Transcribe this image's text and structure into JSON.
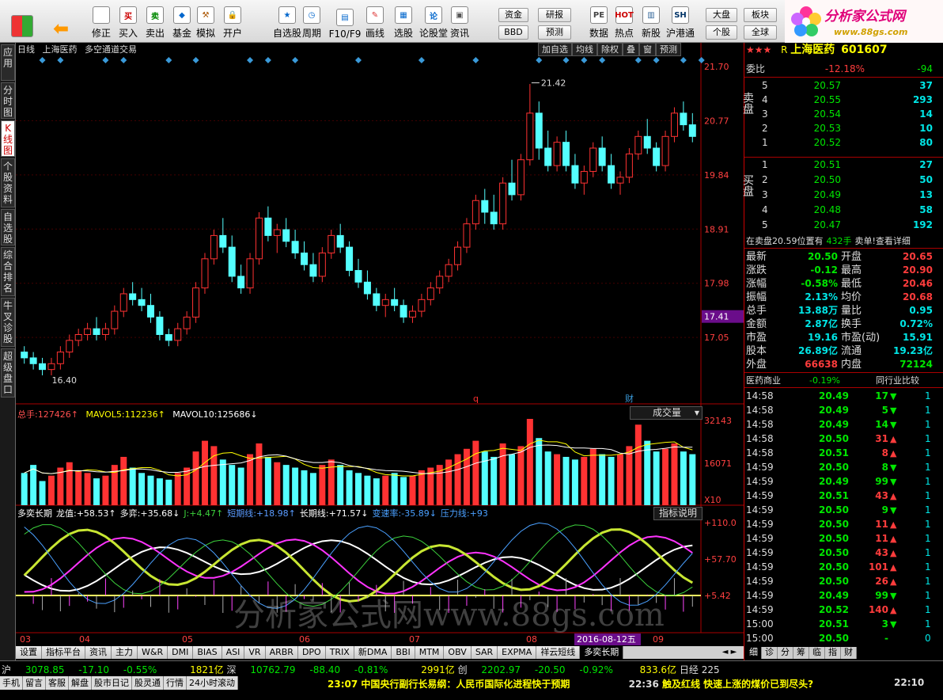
{
  "toolbar": {
    "buttons": [
      {
        "label": "修正",
        "icon": "back-arrow-icon"
      },
      {
        "label": "买入",
        "icon": "buy-icon",
        "glyph": "买"
      },
      {
        "label": "卖出",
        "icon": "sell-icon",
        "glyph": "卖"
      },
      {
        "label": "基金",
        "icon": "fund-icon",
        "glyph": "◆"
      },
      {
        "label": "模拟",
        "icon": "hammer-icon",
        "glyph": "⚒"
      },
      {
        "label": "开户",
        "icon": "lock-icon",
        "glyph": "🔒"
      },
      {
        "label": "自选股",
        "icon": "star-icon",
        "glyph": "★"
      },
      {
        "label": "周期",
        "icon": "clock-icon",
        "glyph": "◷"
      },
      {
        "label": "F10/F9",
        "icon": "f10-icon",
        "glyph": "▤"
      },
      {
        "label": "画线",
        "icon": "pen-icon",
        "glyph": "✎"
      },
      {
        "label": "选股",
        "icon": "chart-icon",
        "glyph": "▦"
      },
      {
        "label": "论股堂",
        "icon": "talk-icon",
        "glyph": "论"
      },
      {
        "label": "资讯",
        "icon": "info-icon",
        "glyph": "▣"
      },
      {
        "label": "数据",
        "icon": "pe-icon",
        "glyph": "PE"
      },
      {
        "label": "热点",
        "icon": "hot-icon",
        "glyph": "HOT"
      },
      {
        "label": "新股",
        "icon": "newstock-icon",
        "glyph": "▥"
      },
      {
        "label": "沪港通",
        "icon": "hk-icon",
        "glyph": "SH"
      }
    ],
    "small": [
      "资金",
      "BBD",
      "研报",
      "预测",
      "大盘",
      "个股",
      "板块",
      "全球"
    ],
    "logo_title": "分析家公式网",
    "logo_url": "www.88gs.com"
  },
  "left_tabs": [
    "应用",
    "分时图",
    "K线图",
    "个股资料",
    "自选股",
    "综合排名",
    "牛叉诊股",
    "超级盘口"
  ],
  "chart": {
    "header": {
      "period": "日线",
      "stock": "上海医药",
      "formula": "多空通道交易"
    },
    "header_btns": [
      "加自选",
      "均线",
      "除权",
      "叠",
      "窗",
      "预测"
    ],
    "price_axis": [
      "21.70",
      "20.77",
      "19.84",
      "18.91",
      "17.98",
      "17.05"
    ],
    "current_price_label": "17.41",
    "high_mark": "21.42",
    "low_mark": "16.40",
    "event_labels": [
      "q",
      "财"
    ],
    "vol_header": {
      "label": "总手:",
      "total": "127426↑",
      "mavol5_label": "MAVOL5:",
      "mavol5": "112236↑",
      "mavol10_label": "MAVOL10:",
      "mavol10": "125686↓"
    },
    "vol_menu": "成交量",
    "vol_axis": [
      "32143",
      "16071"
    ],
    "vol_unit": "X10",
    "ind_header": {
      "name": "多奕长期",
      "items": [
        {
          "t": "龙值:",
          "v": "+58.53↑",
          "c": "#fff"
        },
        {
          "t": "多弈:",
          "v": "+35.68↓",
          "c": "#fff"
        },
        {
          "t": "J:",
          "v": "+4.47↑",
          "c": "#3cd23c"
        },
        {
          "t": "短期线:",
          "v": "+18.98↑",
          "c": "#5a9bff"
        },
        {
          "t": "长期线:",
          "v": "+71.57↓",
          "c": "#fff"
        },
        {
          "t": "变速率:",
          "v": "-35.89↓",
          "c": "#4aa0ff"
        },
        {
          "t": "压力线:",
          "v": "+93",
          "c": "#4aa0ff"
        }
      ]
    },
    "ind_menu": "指标说明",
    "ind_axis": [
      "+110.0",
      "+57.70",
      "+5.42"
    ],
    "watermark": "分析家公式网www.88gs.com",
    "months": [
      "03",
      "04",
      "05",
      "06",
      "07",
      "08",
      "09"
    ],
    "date_highlight": "2016-08-12五"
  },
  "chart_data": {
    "type": "candlestick",
    "title": "上海医药 日线",
    "ylim": [
      16.4,
      21.7
    ],
    "candles": [
      [
        16.8,
        16.9,
        16.6,
        16.7
      ],
      [
        16.7,
        16.8,
        16.5,
        16.6
      ],
      [
        16.6,
        16.7,
        16.4,
        16.5
      ],
      [
        16.5,
        16.7,
        16.4,
        16.6
      ],
      [
        16.6,
        16.9,
        16.5,
        16.8
      ],
      [
        16.8,
        17.1,
        16.7,
        17.0
      ],
      [
        17.0,
        17.2,
        16.9,
        17.1
      ],
      [
        17.1,
        17.3,
        17.0,
        17.2
      ],
      [
        17.2,
        17.4,
        17.0,
        17.1
      ],
      [
        17.1,
        17.3,
        17.0,
        17.2
      ],
      [
        17.2,
        17.6,
        17.1,
        17.5
      ],
      [
        17.5,
        17.9,
        17.4,
        17.8
      ],
      [
        17.8,
        18.0,
        17.6,
        17.7
      ],
      [
        17.7,
        17.9,
        17.5,
        17.6
      ],
      [
        17.6,
        17.8,
        17.3,
        17.4
      ],
      [
        17.4,
        17.5,
        17.0,
        17.1
      ],
      [
        17.1,
        17.2,
        16.9,
        17.0
      ],
      [
        17.0,
        17.3,
        16.9,
        17.2
      ],
      [
        17.2,
        17.5,
        17.1,
        17.4
      ],
      [
        17.4,
        18.0,
        17.3,
        17.9
      ],
      [
        17.9,
        18.5,
        17.8,
        18.4
      ],
      [
        18.4,
        18.9,
        18.3,
        18.8
      ],
      [
        18.8,
        19.1,
        18.5,
        18.6
      ],
      [
        18.6,
        18.8,
        18.0,
        18.1
      ],
      [
        18.1,
        18.3,
        17.8,
        17.9
      ],
      [
        17.9,
        18.5,
        17.8,
        18.4
      ],
      [
        18.4,
        19.2,
        18.3,
        19.1
      ],
      [
        19.1,
        19.3,
        18.7,
        18.8
      ],
      [
        18.8,
        19.0,
        18.5,
        18.9
      ],
      [
        18.9,
        19.1,
        18.6,
        18.7
      ],
      [
        18.7,
        18.9,
        18.4,
        18.5
      ],
      [
        18.5,
        18.7,
        18.2,
        18.3
      ],
      [
        18.3,
        18.5,
        18.0,
        18.1
      ],
      [
        18.1,
        18.6,
        18.0,
        18.5
      ],
      [
        18.5,
        18.9,
        18.4,
        18.8
      ],
      [
        18.8,
        19.0,
        18.5,
        18.6
      ],
      [
        18.6,
        18.7,
        18.1,
        18.2
      ],
      [
        18.2,
        18.4,
        17.9,
        18.0
      ],
      [
        18.0,
        18.2,
        17.7,
        17.8
      ],
      [
        17.8,
        17.9,
        17.5,
        17.6
      ],
      [
        17.6,
        17.8,
        17.4,
        17.7
      ],
      [
        17.7,
        17.9,
        17.5,
        17.6
      ],
      [
        17.6,
        17.7,
        17.3,
        17.4
      ],
      [
        17.4,
        17.6,
        17.3,
        17.5
      ],
      [
        17.5,
        17.8,
        17.4,
        17.7
      ],
      [
        17.7,
        18.0,
        17.6,
        17.9
      ],
      [
        17.9,
        18.2,
        17.8,
        18.1
      ],
      [
        18.1,
        18.4,
        18.0,
        18.3
      ],
      [
        18.3,
        18.7,
        18.2,
        18.6
      ],
      [
        18.6,
        19.1,
        18.5,
        19.0
      ],
      [
        19.0,
        19.5,
        18.9,
        19.4
      ],
      [
        19.4,
        19.6,
        19.0,
        19.2
      ],
      [
        19.2,
        19.5,
        18.9,
        19.0
      ],
      [
        19.0,
        19.8,
        18.9,
        19.7
      ],
      [
        19.7,
        20.1,
        19.4,
        19.5
      ],
      [
        19.5,
        20.2,
        19.4,
        20.1
      ],
      [
        20.1,
        21.4,
        20.0,
        20.9
      ],
      [
        20.9,
        21.1,
        20.1,
        20.3
      ],
      [
        20.3,
        20.6,
        19.9,
        20.0
      ],
      [
        20.0,
        20.5,
        19.9,
        20.4
      ],
      [
        20.4,
        20.6,
        19.9,
        20.0
      ],
      [
        20.0,
        20.2,
        19.6,
        19.7
      ],
      [
        19.7,
        20.0,
        19.5,
        19.9
      ],
      [
        19.9,
        20.4,
        19.8,
        20.3
      ],
      [
        20.3,
        20.5,
        19.9,
        20.0
      ],
      [
        20.0,
        20.2,
        19.6,
        19.7
      ],
      [
        19.7,
        19.9,
        19.5,
        19.8
      ],
      [
        19.8,
        20.3,
        19.7,
        20.2
      ],
      [
        20.2,
        20.6,
        20.1,
        20.5
      ],
      [
        20.5,
        20.8,
        20.2,
        20.3
      ],
      [
        20.3,
        20.4,
        19.9,
        20.0
      ],
      [
        20.0,
        20.6,
        19.9,
        20.5
      ],
      [
        20.5,
        21.0,
        20.4,
        20.9
      ],
      [
        20.9,
        21.1,
        20.6,
        20.7
      ],
      [
        20.7,
        20.9,
        20.4,
        20.5
      ]
    ],
    "volume": [
      12000,
      15000,
      9000,
      11000,
      14000,
      16000,
      13000,
      12000,
      10000,
      11000,
      15000,
      18000,
      14000,
      12000,
      11000,
      10000,
      9500,
      12000,
      14000,
      20000,
      24000,
      22000,
      17000,
      15000,
      14000,
      19000,
      23000,
      18000,
      16000,
      15000,
      14000,
      13000,
      12000,
      15000,
      17000,
      15000,
      13000,
      12000,
      11000,
      10000,
      11000,
      12000,
      10500,
      11000,
      13000,
      14000,
      15000,
      17000,
      19000,
      21000,
      24000,
      20000,
      18000,
      23000,
      19000,
      22000,
      32143,
      25000,
      20000,
      19000,
      18000,
      17000,
      18000,
      21000,
      19000,
      18000,
      19000,
      22000,
      30000,
      24000,
      20000,
      21000,
      23000,
      20000,
      19000
    ]
  },
  "quote": {
    "stars": "★★★",
    "flag": "R",
    "name": "上海医药",
    "code": "601607",
    "weibi_label": "委比",
    "weibi": "-12.18%",
    "weicha": "-94",
    "sell_label": "卖盘",
    "buy_label": "买盘",
    "sells": [
      [
        "5",
        "20.57",
        "37"
      ],
      [
        "4",
        "20.55",
        "293"
      ],
      [
        "3",
        "20.54",
        "14"
      ],
      [
        "2",
        "20.53",
        "10"
      ],
      [
        "1",
        "20.52",
        "80"
      ]
    ],
    "buys": [
      [
        "1",
        "20.51",
        "27"
      ],
      [
        "2",
        "20.50",
        "50"
      ],
      [
        "3",
        "20.49",
        "13"
      ],
      [
        "4",
        "20.48",
        "58"
      ],
      [
        "5",
        "20.47",
        "192"
      ]
    ],
    "notice": "在卖盘20.59位置有",
    "notice_qty": "432手",
    "notice_tail": "卖单!查看详细",
    "stats": [
      [
        "最新",
        "20.50",
        "开盘",
        "20.65"
      ],
      [
        "涨跌",
        "-0.12",
        "最高",
        "20.90"
      ],
      [
        "涨幅",
        "-0.58%",
        "最低",
        "20.46"
      ],
      [
        "振幅",
        "2.13%",
        "均价",
        "20.68"
      ],
      [
        "总手",
        "13.88万",
        "量比",
        "0.95"
      ],
      [
        "金额",
        "2.87亿",
        "换手",
        "0.72%"
      ],
      [
        "市盈",
        "19.16",
        "市盈(动)",
        "15.91"
      ],
      [
        "股本",
        "26.89亿",
        "流通",
        "19.23亿"
      ],
      [
        "外盘",
        "66638",
        "内盘",
        "72124"
      ]
    ],
    "industry": "医药商业",
    "industry_pct": "-0.19%",
    "industry_cmp": "同行业比较",
    "ticks": [
      [
        "14:58",
        "20.49",
        "17",
        "d",
        "1"
      ],
      [
        "14:58",
        "20.49",
        "5",
        "d",
        "1"
      ],
      [
        "14:58",
        "20.49",
        "14",
        "d",
        "1"
      ],
      [
        "14:58",
        "20.50",
        "31",
        "u",
        "1"
      ],
      [
        "14:58",
        "20.51",
        "8",
        "u",
        "1"
      ],
      [
        "14:59",
        "20.50",
        "8",
        "d",
        "1"
      ],
      [
        "14:59",
        "20.49",
        "99",
        "d",
        "1"
      ],
      [
        "14:59",
        "20.51",
        "43",
        "u",
        "1"
      ],
      [
        "14:59",
        "20.50",
        "9",
        "d",
        "1"
      ],
      [
        "14:59",
        "20.50",
        "11",
        "u",
        "1"
      ],
      [
        "14:59",
        "20.50",
        "11",
        "u",
        "1"
      ],
      [
        "14:59",
        "20.50",
        "43",
        "u",
        "1"
      ],
      [
        "14:59",
        "20.50",
        "101",
        "u",
        "1"
      ],
      [
        "14:59",
        "20.50",
        "26",
        "u",
        "1"
      ],
      [
        "14:59",
        "20.49",
        "99",
        "d",
        "1"
      ],
      [
        "14:59",
        "20.52",
        "140",
        "u",
        "1"
      ],
      [
        "15:00",
        "20.51",
        "3",
        "d",
        "1"
      ],
      [
        "15:00",
        "20.50",
        "-",
        "n",
        "0"
      ]
    ],
    "mini_tabs": [
      "细",
      "诊",
      "分",
      "筹",
      "临",
      "指",
      "财"
    ]
  },
  "bottom_tabs": [
    "设置",
    "指标平台",
    "资讯",
    "主力",
    "W&R",
    "DMI",
    "BIAS",
    "ASI",
    "VR",
    "ARBR",
    "DPO",
    "TRIX",
    "新DMA",
    "BBI",
    "MTM",
    "OBV",
    "SAR",
    "EXPMA",
    "祥云短线",
    "多奕长期"
  ],
  "status": {
    "sh_label": "沪",
    "sh_index": "3078.85",
    "sh_chg": "-17.10",
    "sh_pct": "-0.55%",
    "sh_amt": "1821亿",
    "sz_label": "深",
    "sz_index": "10762.79",
    "sz_chg": "-88.40",
    "sz_pct": "-0.81%",
    "sz_amt": "2991亿",
    "cy_label": "创",
    "cy_index": "2202.97",
    "cy_chg": "-20.50",
    "cy_pct": "-0.92%",
    "cy_amt": "833.6亿",
    "rj_label": "日经",
    "rj_index": "225",
    "menu": [
      "手机",
      "留言",
      "客服",
      "解盘",
      "股市日记",
      "股灵通",
      "行情",
      "24小时滚动"
    ],
    "news1_time": "23:07",
    "news1": "中国央行副行长易纲：人民币国际化进程快于预期",
    "news2_time": "22:36",
    "news2": "触及红线 快速上涨的煤价已到尽头?",
    "clock": "22:10"
  }
}
